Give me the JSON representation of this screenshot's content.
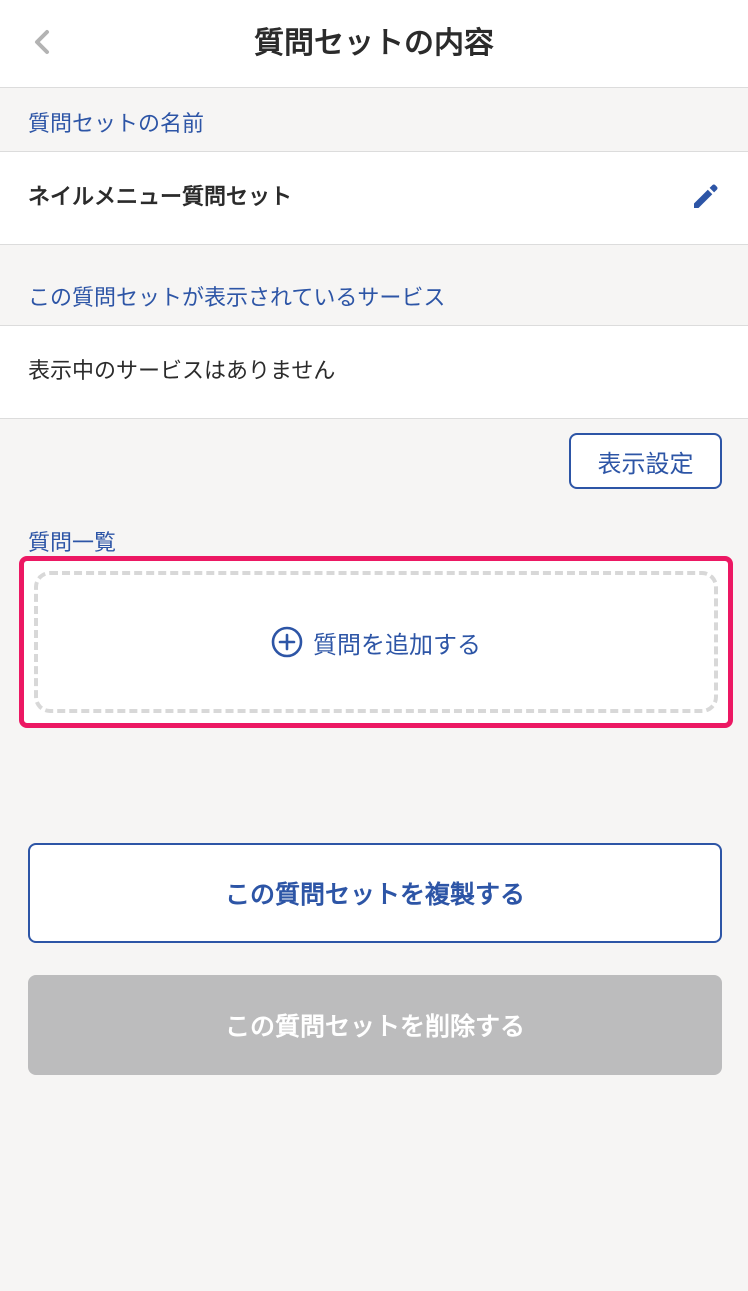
{
  "header": {
    "title": "質問セットの内容",
    "back_icon": "chevron-left-icon"
  },
  "name_section": {
    "label": "質問セットの名前",
    "value": "ネイルメニュー質問セット",
    "edit_icon": "pencil-icon"
  },
  "services_section": {
    "label": "この質問セットが表示されているサービス",
    "empty_text": "表示中のサービスはありません",
    "settings_button_label": "表示設定"
  },
  "questions_section": {
    "label": "質問一覧",
    "add_question_label": "質問を追加する",
    "add_icon": "plus-circle-icon"
  },
  "actions": {
    "duplicate_label": "この質問セットを複製する",
    "delete_label": "この質問セットを削除する"
  },
  "colors": {
    "accent": "#2d55a6",
    "highlight": "#ec1863",
    "delete_bg": "#bcbcbd",
    "page_bg": "#f6f5f4"
  }
}
